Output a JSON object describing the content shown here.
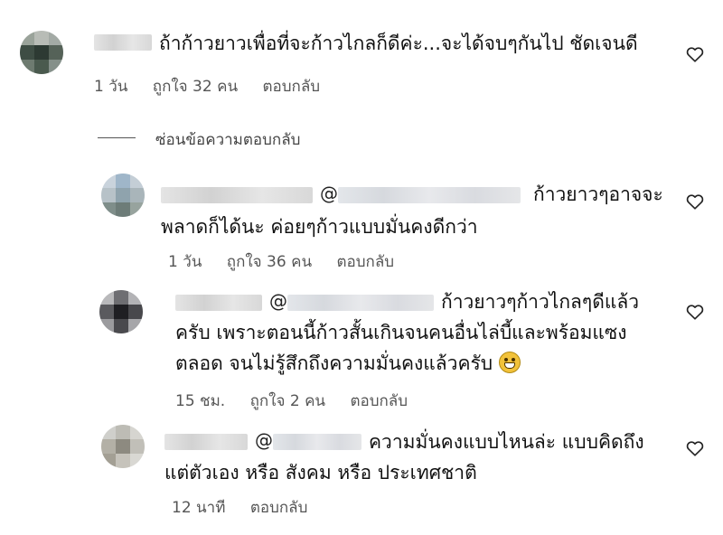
{
  "comments": [
    {
      "text_lines": [
        "ถ้าก้าวยาวเพื่อที่จะก้าวไกลก็ดีค่ะ...จะได้จบๆกันไป ชัดเจนดี"
      ],
      "time": "1 วัน",
      "likes": "ถูกใจ 32 คน",
      "reply": "ตอบกลับ"
    }
  ],
  "hide_replies": "ซ่อนข้อความตอบกลับ",
  "replies": [
    {
      "text_lines": [
        "ก้าวยาวๆอาจจะ",
        "พลาดก็ได้นะ ค่อยๆก้าวแบบมั่นคงดีกว่า"
      ],
      "time": "1 วัน",
      "likes": "ถูกใจ 36 คน",
      "reply": "ตอบกลับ"
    },
    {
      "text_lines": [
        "ก้าวยาวๆก้าวไกลๆดีแล้ว",
        "ครับ เพราะตอนนี้ก้าวสั้นเกินจนคนอื่นไล่บี้และพร้อมแซง",
        "ตลอด จนไม่รู้สึกถึงความมั่นคงแล้วครับ"
      ],
      "time": "15 ชม.",
      "likes": "ถูกใจ 2 คน",
      "reply": "ตอบกลับ"
    },
    {
      "text_lines": [
        "ความมั่นคงแบบไหนล่ะ แบบคิดถึง",
        "แต่ตัวเอง หรือ สังคม หรือ ประเทศชาติ"
      ],
      "time": "12 นาที",
      "reply": "ตอบกลับ"
    }
  ],
  "mention_symbol": "@",
  "icons": {
    "like": "heart-outline-icon",
    "emoji": "grinning-face-emoji"
  }
}
